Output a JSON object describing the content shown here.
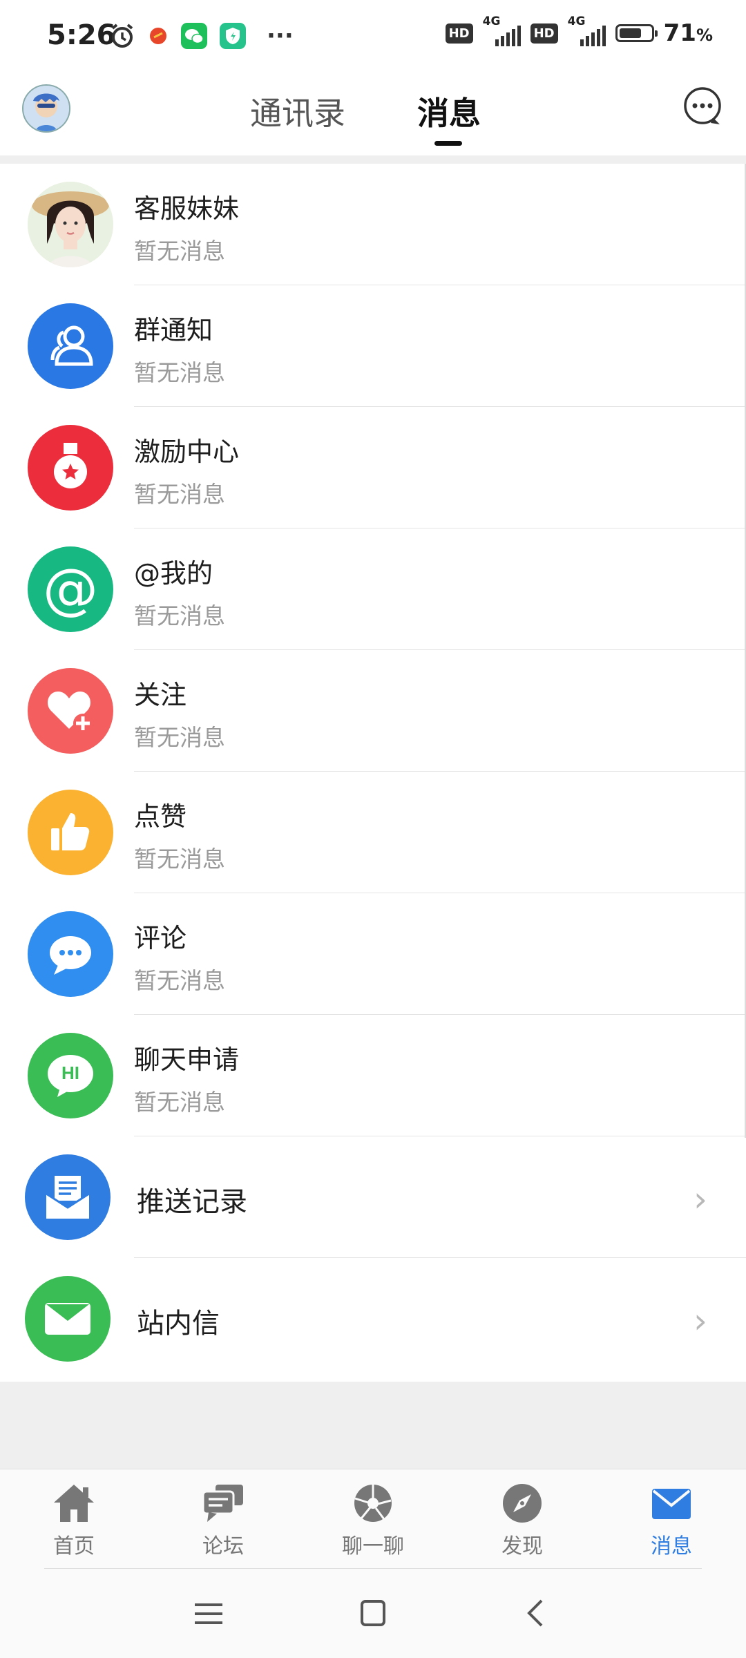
{
  "status_bar": {
    "time": "5:26",
    "network_1": "4G",
    "network_2": "4G",
    "hd_1": "HD",
    "hd_2": "HD",
    "battery_percent": "71",
    "battery_unit": "%",
    "battery_level": 0.71,
    "more": "···"
  },
  "header": {
    "tabs": [
      {
        "label": "通讯录"
      },
      {
        "label": "消息"
      }
    ],
    "active_tab": "消息"
  },
  "messages": [
    {
      "title": "客服妹妹",
      "subtitle": "暂无消息",
      "icon": "customer-service-avatar"
    },
    {
      "title": "群通知",
      "subtitle": "暂无消息",
      "icon": "group-icon",
      "color": "#2a78e4"
    },
    {
      "title": "激励中心",
      "subtitle": "暂无消息",
      "icon": "medal-icon",
      "color": "#ec2d3c"
    },
    {
      "title": "@我的",
      "subtitle": "暂无消息",
      "icon": "at-icon",
      "color": "#17b882",
      "glyph": "@"
    },
    {
      "title": "关注",
      "subtitle": "暂无消息",
      "icon": "heart-plus-icon",
      "color": "#f45e5e"
    },
    {
      "title": "点赞",
      "subtitle": "暂无消息",
      "icon": "thumbs-up-icon",
      "color": "#fbb230"
    },
    {
      "title": "评论",
      "subtitle": "暂无消息",
      "icon": "comment-icon",
      "color": "#2f8ef0"
    },
    {
      "title": "聊天申请",
      "subtitle": "暂无消息",
      "icon": "chat-request-icon",
      "color": "#3bbd55",
      "glyph": "HI"
    }
  ],
  "nav_rows": [
    {
      "title": "推送记录",
      "icon": "push-record-icon",
      "color": "#2f7de1",
      "chevron": "›"
    },
    {
      "title": "站内信",
      "icon": "mail-icon",
      "color": "#3bbd55",
      "chevron": "›"
    }
  ],
  "bottom_nav": [
    {
      "label": "首页",
      "icon": "home-icon"
    },
    {
      "label": "论坛",
      "icon": "forum-icon"
    },
    {
      "label": "聊一聊",
      "icon": "chat-aperture-icon"
    },
    {
      "label": "发现",
      "icon": "compass-icon"
    },
    {
      "label": "消息",
      "icon": "envelope-icon",
      "active": true
    }
  ],
  "colors": {
    "active_blue": "#2f7de1",
    "inactive_gray": "#777777",
    "subtitle_gray": "#9a9a9a"
  }
}
